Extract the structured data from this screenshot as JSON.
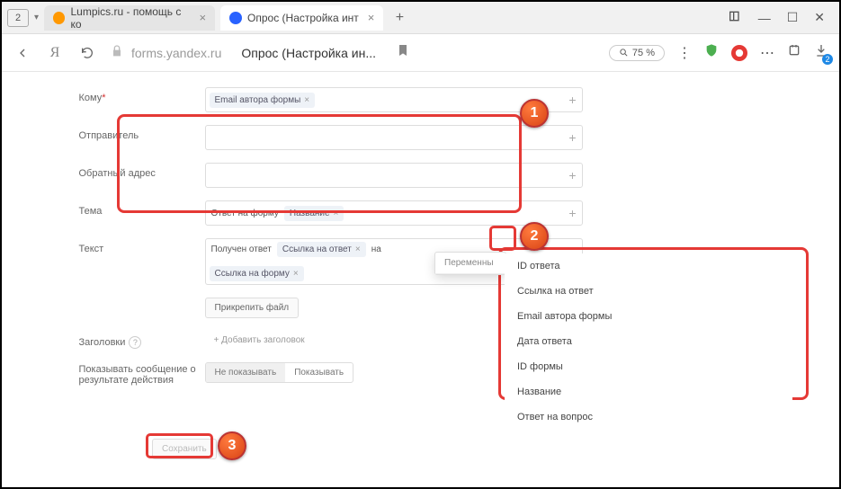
{
  "tabs": {
    "count": "2",
    "tab1": "Lumpics.ru - помощь с ко",
    "tab2": "Опрос (Настройка инт"
  },
  "addr": {
    "host": "forms.yandex.ru",
    "title": "Опрос (Настройка ин...",
    "zoom": "75 %"
  },
  "labels": {
    "to": "Кому",
    "from": "Отправитель",
    "reply": "Обратный адрес",
    "subject": "Тема",
    "text": "Текст",
    "headers": "Заголовки",
    "show_result": "Показывать сообщение о результате действия"
  },
  "chips": {
    "to": "Email автора формы",
    "subj_prefix": "Ответ на форму",
    "subj_var": "Название",
    "text_prefix": "Получен ответ",
    "text_var1": "Ссылка на ответ",
    "text_mid": "на",
    "text_var2": "Ссылка на форму"
  },
  "buttons": {
    "attach": "Прикрепить файл",
    "add_header": "Добавить заголовок",
    "hide": "Не показывать",
    "show": "Показывать",
    "save": "Сохранить"
  },
  "dropdown": {
    "header": "Переменны",
    "items": [
      "ID ответа",
      "Ссылка на ответ",
      "Email автора формы",
      "Дата ответа",
      "ID формы",
      "Название",
      "Ответ на вопрос"
    ]
  },
  "markers": {
    "m1": "1",
    "m2": "2",
    "m3": "3"
  }
}
